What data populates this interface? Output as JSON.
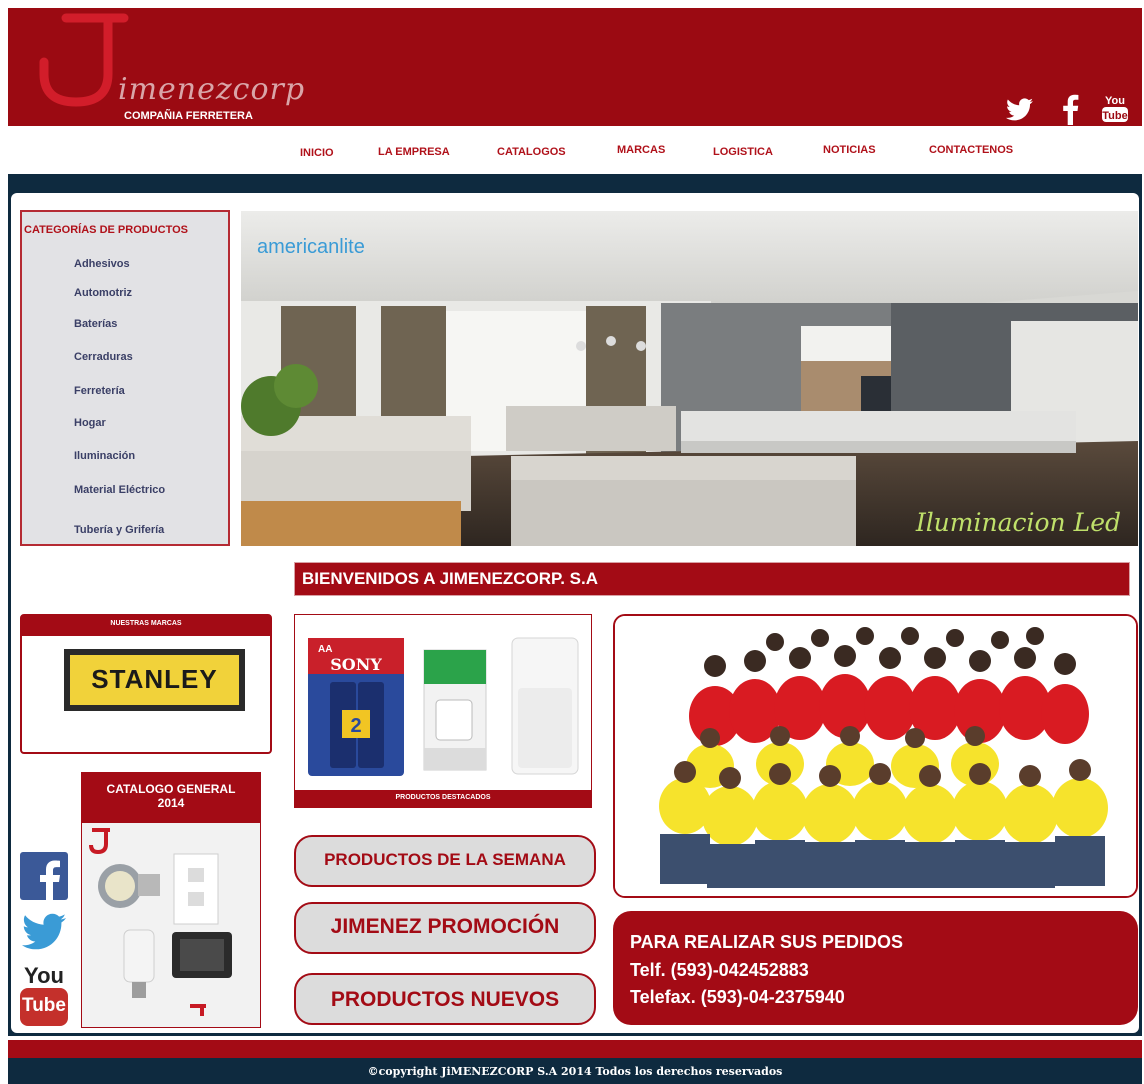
{
  "header": {
    "logo_text": "imenezcorp",
    "logo_subtitle": "COMPAÑIA FERRETERA",
    "social_icons": [
      "twitter-icon",
      "facebook-icon",
      "youtube-icon"
    ]
  },
  "nav": {
    "items": [
      "INICIO",
      "LA EMPRESA",
      "CATALOGOS",
      "MARCAS",
      "LOGISTICA",
      "NOTICIAS",
      "CONTACTENOS"
    ]
  },
  "categories": {
    "title": "CATEGORÍAS DE PRODUCTOS",
    "items": [
      "Adhesivos",
      "Automotriz",
      "Baterías",
      "Cerraduras",
      "Ferretería",
      "Hogar",
      "Iluminación",
      "Material Eléctrico",
      "Tubería y Grifería"
    ]
  },
  "banner": {
    "brand": "americanlite",
    "caption": "Iluminacion Led"
  },
  "welcome": {
    "text": "BIENVENIDOS A JIMENEZCORP. S.A"
  },
  "brands": {
    "title": "NUESTRAS MARCAS",
    "logo": "STANLEY"
  },
  "catalog": {
    "title_line1": "CATALOGO GENERAL",
    "title_line2": "2014"
  },
  "featured": {
    "title": "PRODUCTOS DESTACADOS",
    "battery_brand": "SONY",
    "battery_size": "AA",
    "battery_count": "2"
  },
  "buttons": {
    "week": "PRODUCTOS DE LA SEMANA",
    "promo": "JIMENEZ PROMOCIÓN",
    "new": "PRODUCTOS NUEVOS"
  },
  "side_social": {
    "youtube_you": "You",
    "youtube_tube": "Tube"
  },
  "contact": {
    "heading": "PARA REALIZAR SUS PEDIDOS",
    "phone": "Telf. (593)-042452883",
    "fax": "Telefax. (593)-04-2375940"
  },
  "footer": {
    "text": "©copyright JiMENEZCORP S.A 2014  Todos los derechos reservados"
  },
  "colors": {
    "brand_red": "#9b0a12",
    "navy": "#0e2a3f",
    "nav_text": "#b0111a"
  }
}
